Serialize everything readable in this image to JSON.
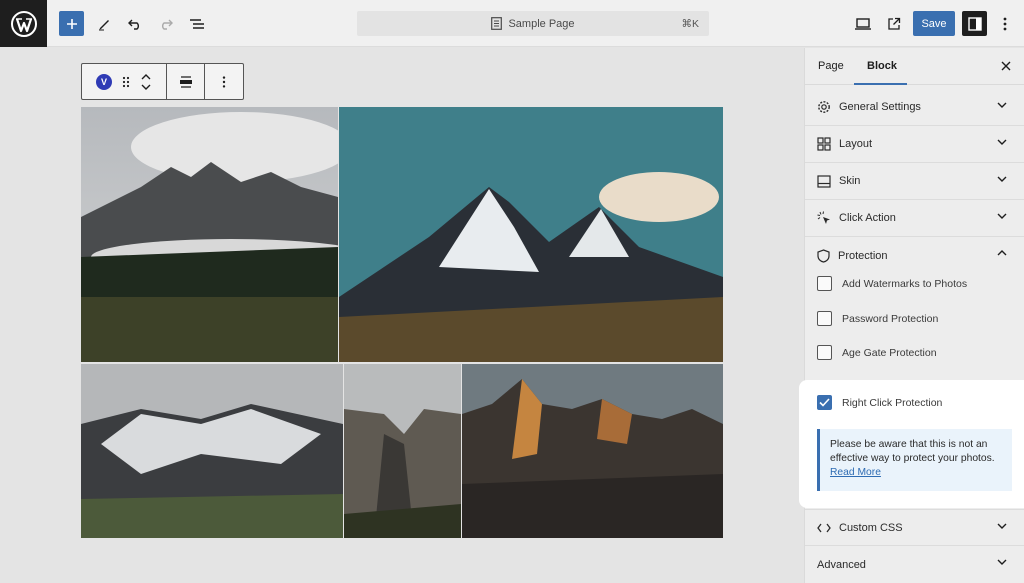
{
  "topbar": {
    "document_title": "Sample Page",
    "shortcut": "⌘K",
    "save_label": "Save"
  },
  "block_toolbar": {
    "block_badge": "V"
  },
  "sidebar": {
    "tabs": [
      {
        "label": "Page",
        "active": false
      },
      {
        "label": "Block",
        "active": true
      }
    ],
    "panels": [
      {
        "label": "General Settings",
        "icon": "gear-icon",
        "expanded": false
      },
      {
        "label": "Layout",
        "icon": "layout-grid-icon",
        "expanded": false
      },
      {
        "label": "Skin",
        "icon": "skin-icon",
        "expanded": false
      },
      {
        "label": "Click Action",
        "icon": "click-icon",
        "expanded": false
      },
      {
        "label": "Protection",
        "icon": "shield-icon",
        "expanded": true
      }
    ],
    "protection_options": [
      {
        "label": "Add Watermarks to Photos",
        "checked": false
      },
      {
        "label": "Password Protection",
        "checked": false
      },
      {
        "label": "Age Gate Protection",
        "checked": false
      },
      {
        "label": "Right Click Protection",
        "checked": true
      }
    ],
    "notice": {
      "text": "Please be aware that this is not an effective way to protect your photos.",
      "link": "Read More"
    },
    "bottom_panels": [
      {
        "label": "Custom CSS",
        "icon": "code-icon"
      },
      {
        "label": "Advanced",
        "icon": ""
      }
    ]
  },
  "colors": {
    "accent": "#3a6fb0",
    "dark": "#1e1e1e",
    "notice_bg": "#eaf3fb"
  }
}
